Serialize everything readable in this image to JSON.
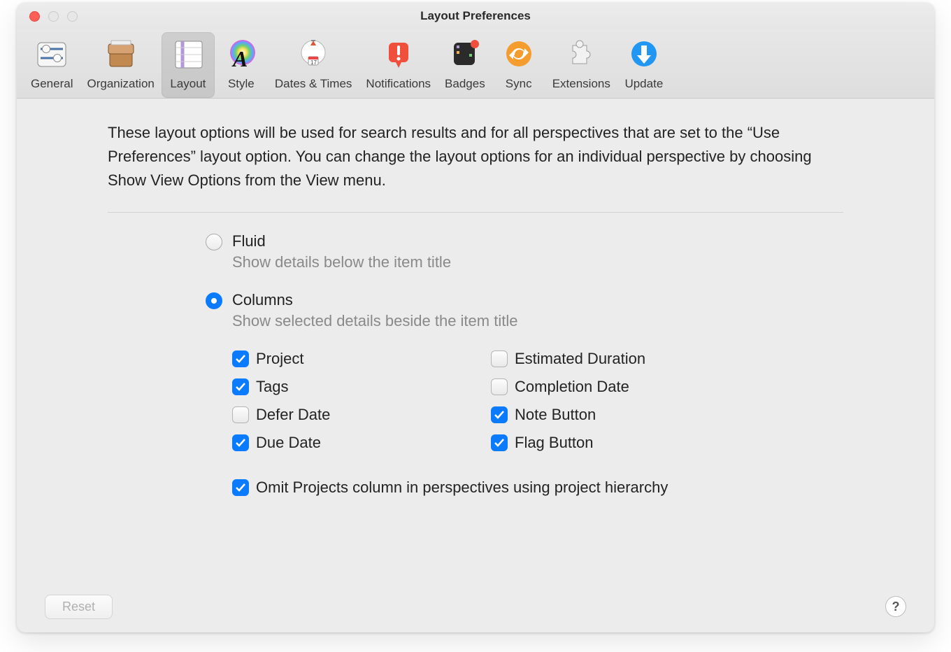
{
  "window": {
    "title": "Layout Preferences"
  },
  "toolbar": {
    "tabs": [
      {
        "label": "General"
      },
      {
        "label": "Organization"
      },
      {
        "label": "Layout"
      },
      {
        "label": "Style"
      },
      {
        "label": "Dates & Times"
      },
      {
        "label": "Notifications"
      },
      {
        "label": "Badges"
      },
      {
        "label": "Sync"
      },
      {
        "label": "Extensions"
      },
      {
        "label": "Update"
      }
    ]
  },
  "description": "These layout options will be used for search results and for all perspectives that are set to the “Use Preferences” layout option. You can change the layout options for an individual perspective by choosing Show View Options from the View menu.",
  "layoutMode": {
    "fluid": {
      "label": "Fluid",
      "sub": "Show details below the item title",
      "selected": false
    },
    "columns": {
      "label": "Columns",
      "sub": "Show selected details beside the item title",
      "selected": true
    }
  },
  "columns": {
    "left": [
      {
        "label": "Project",
        "checked": true
      },
      {
        "label": "Tags",
        "checked": true
      },
      {
        "label": "Defer Date",
        "checked": false
      },
      {
        "label": "Due Date",
        "checked": true
      }
    ],
    "right": [
      {
        "label": "Estimated Duration",
        "checked": false
      },
      {
        "label": "Completion Date",
        "checked": false
      },
      {
        "label": "Note Button",
        "checked": true
      },
      {
        "label": "Flag Button",
        "checked": true
      }
    ]
  },
  "omit": {
    "label": "Omit Projects column in perspectives using project hierarchy",
    "checked": true
  },
  "footer": {
    "reset": "Reset",
    "help": "?"
  }
}
